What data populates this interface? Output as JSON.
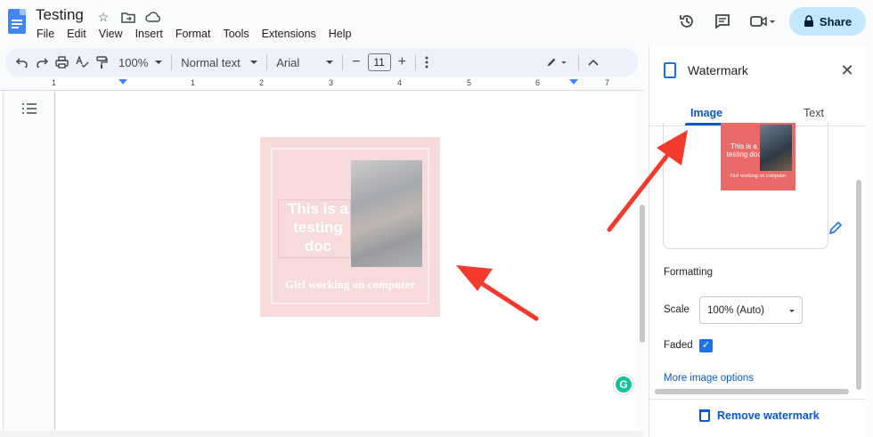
{
  "app": {
    "doc_title": "Testing",
    "menus": [
      "File",
      "Edit",
      "View",
      "Insert",
      "Format",
      "Tools",
      "Extensions",
      "Help"
    ],
    "share_label": "Share"
  },
  "toolbar": {
    "zoom": "100%",
    "style": "Normal text",
    "font": "Arial",
    "font_size": "11",
    "minus": "−",
    "plus": "+"
  },
  "ruler": {
    "numbers": [
      "1",
      "1",
      "2",
      "3",
      "4",
      "5",
      "6",
      "7"
    ]
  },
  "watermark": {
    "label_text": "This is a testing doc",
    "caption": "Girl working on computer"
  },
  "panel": {
    "title": "Watermark",
    "tabs": [
      "Image",
      "Text"
    ],
    "preview_text": "This is a testing doc",
    "preview_caption": "Girl working on computer",
    "formatting_label": "Formatting",
    "scale_label": "Scale",
    "scale_value": "100% (Auto)",
    "faded_label": "Faded",
    "faded_checked": true,
    "more_options": "More image options",
    "remove_label": "Remove watermark"
  },
  "colors": {
    "accent": "#0b57d0",
    "share_bg": "#c2e7ff",
    "arrow": "#f23b2d",
    "watermark_bg": "#f7dada"
  }
}
